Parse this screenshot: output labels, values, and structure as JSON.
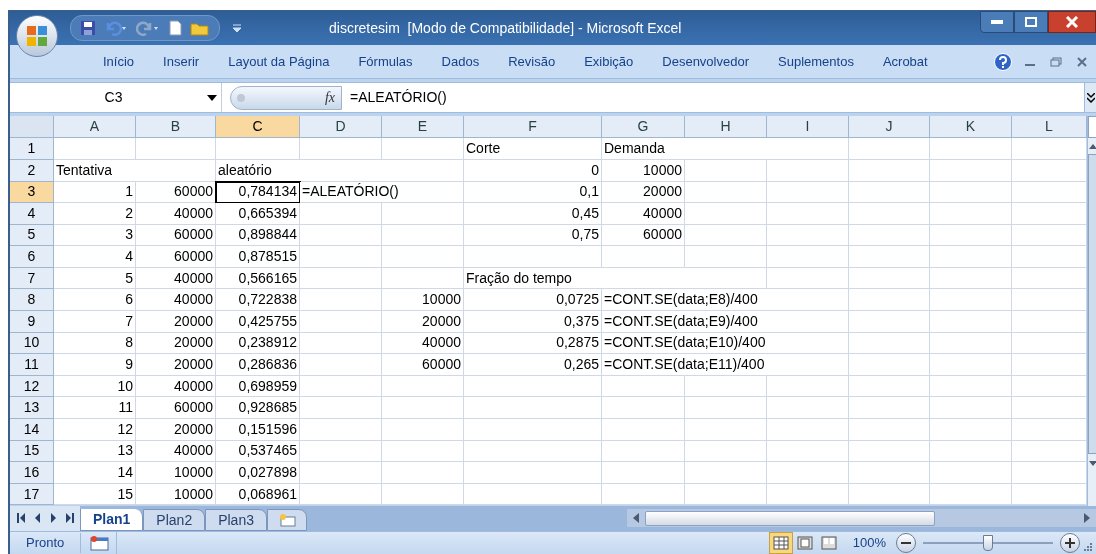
{
  "window": {
    "title": "discretesim  [Modo de Compatibilidade] - Microsoft Excel"
  },
  "ribbon_tabs": [
    "Início",
    "Inserir",
    "Layout da Página",
    "Fórmulas",
    "Dados",
    "Revisão",
    "Exibição",
    "Desenvolvedor",
    "Suplementos",
    "Acrobat"
  ],
  "formula_bar": {
    "name_box": "C3",
    "function_label": "fx",
    "formula": "=ALEATÓRIO()"
  },
  "columns": [
    {
      "label": "A",
      "selected": false
    },
    {
      "label": "B",
      "selected": false
    },
    {
      "label": "C",
      "selected": true
    },
    {
      "label": "D",
      "selected": false
    },
    {
      "label": "E",
      "selected": false
    },
    {
      "label": "F",
      "selected": false
    },
    {
      "label": "G",
      "selected": false
    },
    {
      "label": "H",
      "selected": false
    },
    {
      "label": "I",
      "selected": false
    },
    {
      "label": "J",
      "selected": false
    },
    {
      "label": "K",
      "selected": false
    },
    {
      "label": "L",
      "selected": false
    }
  ],
  "rows": [
    {
      "header": "1",
      "selected": false,
      "cells": [
        null,
        null,
        null,
        null,
        null,
        {
          "text": "Corte",
          "kind": "text"
        },
        {
          "text": "Demanda",
          "kind": "text"
        },
        null,
        null,
        null,
        null,
        null
      ]
    },
    {
      "header": "2",
      "selected": false,
      "cells": [
        {
          "text": "Tentativa",
          "kind": "text"
        },
        null,
        {
          "text": "aleatório",
          "kind": "text"
        },
        null,
        null,
        {
          "text": "0",
          "kind": "number"
        },
        {
          "text": "10000",
          "kind": "number"
        },
        null,
        null,
        null,
        null,
        null
      ]
    },
    {
      "header": "3",
      "selected": true,
      "cells": [
        {
          "text": "1",
          "kind": "number"
        },
        {
          "text": "60000",
          "kind": "number"
        },
        {
          "text": "0,784134",
          "kind": "number"
        },
        {
          "text": "=ALEATÓRIO()",
          "kind": "text"
        },
        null,
        {
          "text": "0,1",
          "kind": "number"
        },
        {
          "text": "20000",
          "kind": "number"
        },
        null,
        null,
        null,
        null,
        null
      ]
    },
    {
      "header": "4",
      "selected": false,
      "cells": [
        {
          "text": "2",
          "kind": "number"
        },
        {
          "text": "40000",
          "kind": "number"
        },
        {
          "text": "0,665394",
          "kind": "number"
        },
        null,
        null,
        {
          "text": "0,45",
          "kind": "number"
        },
        {
          "text": "40000",
          "kind": "number"
        },
        null,
        null,
        null,
        null,
        null
      ]
    },
    {
      "header": "5",
      "selected": false,
      "cells": [
        {
          "text": "3",
          "kind": "number"
        },
        {
          "text": "60000",
          "kind": "number"
        },
        {
          "text": "0,898844",
          "kind": "number"
        },
        null,
        null,
        {
          "text": "0,75",
          "kind": "number"
        },
        {
          "text": "60000",
          "kind": "number"
        },
        null,
        null,
        null,
        null,
        null
      ]
    },
    {
      "header": "6",
      "selected": false,
      "cells": [
        {
          "text": "4",
          "kind": "number"
        },
        {
          "text": "60000",
          "kind": "number"
        },
        {
          "text": "0,878515",
          "kind": "number"
        },
        null,
        null,
        null,
        null,
        null,
        null,
        null,
        null,
        null
      ]
    },
    {
      "header": "7",
      "selected": false,
      "cells": [
        {
          "text": "5",
          "kind": "number"
        },
        {
          "text": "40000",
          "kind": "number"
        },
        {
          "text": "0,566165",
          "kind": "number"
        },
        null,
        null,
        {
          "text": "Fração do tempo",
          "kind": "text"
        },
        null,
        null,
        null,
        null,
        null,
        null
      ]
    },
    {
      "header": "8",
      "selected": false,
      "cells": [
        {
          "text": "6",
          "kind": "number"
        },
        {
          "text": "40000",
          "kind": "number"
        },
        {
          "text": "0,722838",
          "kind": "number"
        },
        null,
        {
          "text": "10000",
          "kind": "number"
        },
        {
          "text": "0,0725",
          "kind": "number"
        },
        {
          "text": "=CONT.SE(data;E8)/400",
          "kind": "text"
        },
        null,
        null,
        null,
        null,
        null
      ]
    },
    {
      "header": "9",
      "selected": false,
      "cells": [
        {
          "text": "7",
          "kind": "number"
        },
        {
          "text": "20000",
          "kind": "number"
        },
        {
          "text": "0,425755",
          "kind": "number"
        },
        null,
        {
          "text": "20000",
          "kind": "number"
        },
        {
          "text": "0,375",
          "kind": "number"
        },
        {
          "text": "=CONT.SE(data;E9)/400",
          "kind": "text"
        },
        null,
        null,
        null,
        null,
        null
      ]
    },
    {
      "header": "10",
      "selected": false,
      "cells": [
        {
          "text": "8",
          "kind": "number"
        },
        {
          "text": "20000",
          "kind": "number"
        },
        {
          "text": "0,238912",
          "kind": "number"
        },
        null,
        {
          "text": "40000",
          "kind": "number"
        },
        {
          "text": "0,2875",
          "kind": "number"
        },
        {
          "text": "=CONT.SE(data;E10)/400",
          "kind": "text"
        },
        null,
        null,
        null,
        null,
        null
      ]
    },
    {
      "header": "11",
      "selected": false,
      "cells": [
        {
          "text": "9",
          "kind": "number"
        },
        {
          "text": "20000",
          "kind": "number"
        },
        {
          "text": "0,286836",
          "kind": "number"
        },
        null,
        {
          "text": "60000",
          "kind": "number"
        },
        {
          "text": "0,265",
          "kind": "number"
        },
        {
          "text": "=CONT.SE(data;E11)/400",
          "kind": "text"
        },
        null,
        null,
        null,
        null,
        null
      ]
    },
    {
      "header": "12",
      "selected": false,
      "cells": [
        {
          "text": "10",
          "kind": "number"
        },
        {
          "text": "40000",
          "kind": "number"
        },
        {
          "text": "0,698959",
          "kind": "number"
        },
        null,
        null,
        null,
        null,
        null,
        null,
        null,
        null,
        null
      ]
    },
    {
      "header": "13",
      "selected": false,
      "cells": [
        {
          "text": "11",
          "kind": "number"
        },
        {
          "text": "60000",
          "kind": "number"
        },
        {
          "text": "0,928685",
          "kind": "number"
        },
        null,
        null,
        null,
        null,
        null,
        null,
        null,
        null,
        null
      ]
    },
    {
      "header": "14",
      "selected": false,
      "cells": [
        {
          "text": "12",
          "kind": "number"
        },
        {
          "text": "20000",
          "kind": "number"
        },
        {
          "text": "0,151596",
          "kind": "number"
        },
        null,
        null,
        null,
        null,
        null,
        null,
        null,
        null,
        null
      ]
    },
    {
      "header": "15",
      "selected": false,
      "cells": [
        {
          "text": "13",
          "kind": "number"
        },
        {
          "text": "40000",
          "kind": "number"
        },
        {
          "text": "0,537465",
          "kind": "number"
        },
        null,
        null,
        null,
        null,
        null,
        null,
        null,
        null,
        null
      ]
    },
    {
      "header": "16",
      "selected": false,
      "cells": [
        {
          "text": "14",
          "kind": "number"
        },
        {
          "text": "10000",
          "kind": "number"
        },
        {
          "text": "0,027898",
          "kind": "number"
        },
        null,
        null,
        null,
        null,
        null,
        null,
        null,
        null,
        null
      ]
    },
    {
      "header": "17",
      "selected": false,
      "cells": [
        {
          "text": "15",
          "kind": "number"
        },
        {
          "text": "10000",
          "kind": "number"
        },
        {
          "text": "0,068961",
          "kind": "number"
        },
        null,
        null,
        null,
        null,
        null,
        null,
        null,
        null,
        null
      ]
    }
  ],
  "sheet_tabs": [
    {
      "label": "Plan1",
      "selected": true
    },
    {
      "label": "Plan2",
      "selected": false
    },
    {
      "label": "Plan3",
      "selected": false
    }
  ],
  "status_bar": {
    "status": "Pronto",
    "zoom": "100%",
    "zoom_slider": {
      "level": 0.5
    }
  }
}
